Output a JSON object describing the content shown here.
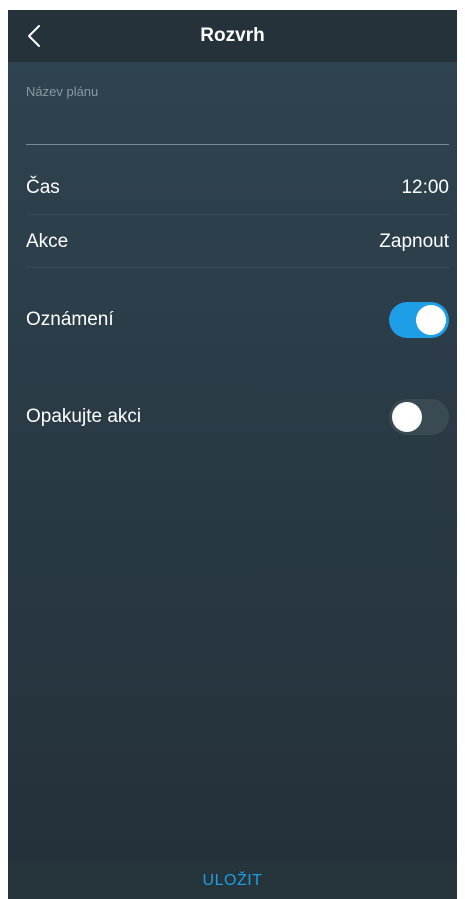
{
  "header": {
    "title": "Rozvrh",
    "back_icon": "chevron-left-icon"
  },
  "form": {
    "name_label": "Název plánu",
    "name_value": "",
    "name_placeholder": ""
  },
  "rows": {
    "time_label": "Čas",
    "time_value": "12:00",
    "action_label": "Akce",
    "action_value": "Zapnout",
    "notify_label": "Oznámení",
    "notify_on": true,
    "repeat_label": "Opakujte akci",
    "repeat_on": false
  },
  "footer": {
    "save_label": "ULOŽIT"
  },
  "colors": {
    "accent": "#1e9ee6",
    "background": "#2a3b46",
    "header": "#253239"
  }
}
